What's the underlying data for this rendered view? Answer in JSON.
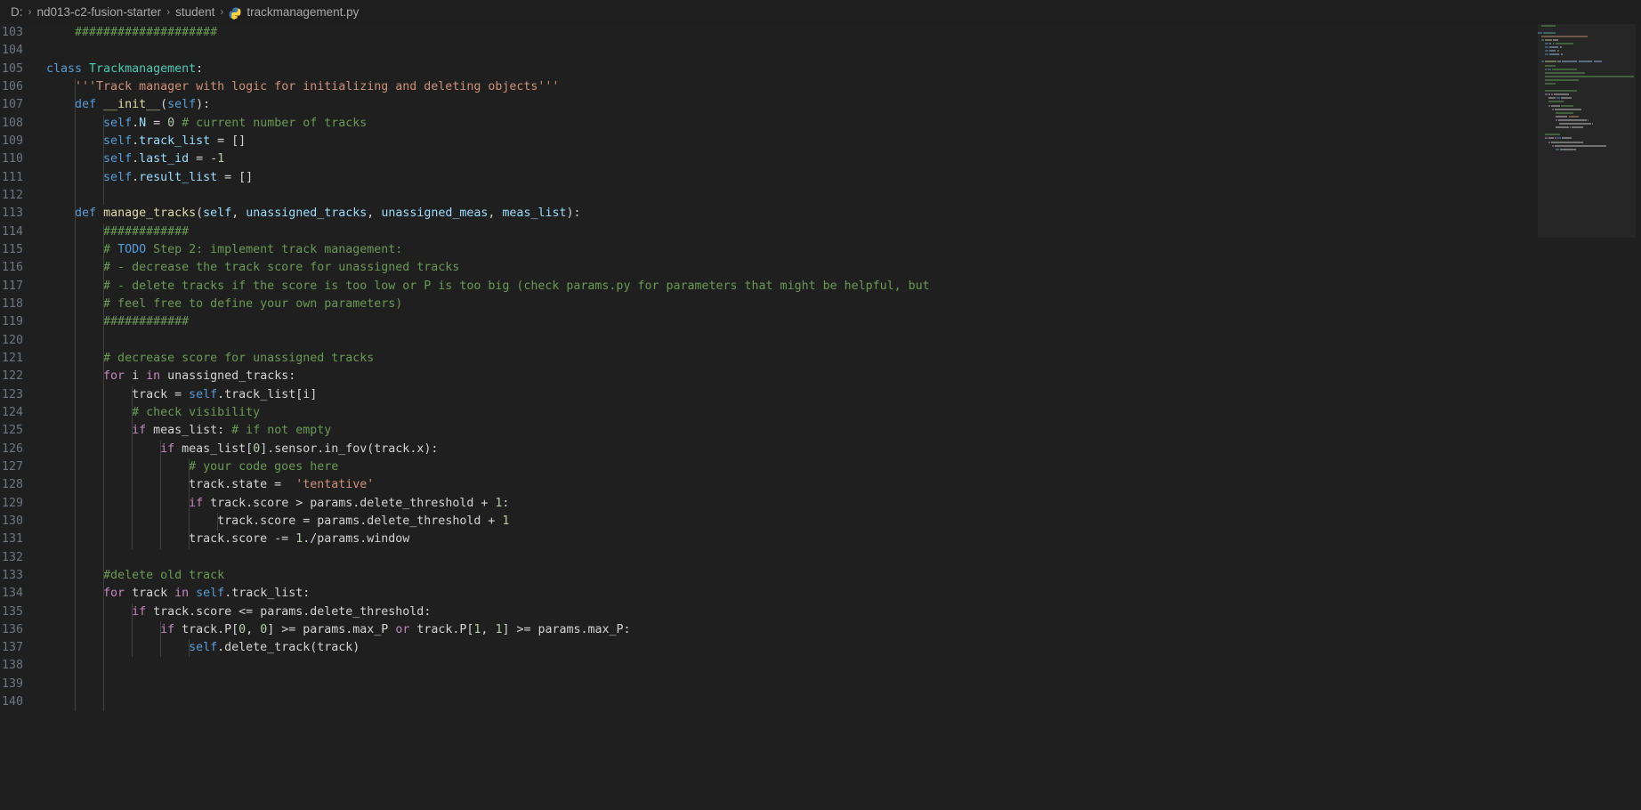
{
  "breadcrumb": {
    "drive": "D:",
    "folder": "nd013-c2-fusion-starter",
    "subfolder": "student",
    "file": "trackmanagement.py",
    "separator": "›",
    "file_icon": "python-file-icon"
  },
  "editor": {
    "language": "python",
    "first_line_number": 103,
    "last_line_number": 140,
    "theme": "dark-plus",
    "colors": {
      "background": "#1f1f1f",
      "line_number": "#6e7681",
      "foreground": "#d4d4d4",
      "keyword": "#c586c0",
      "keyword_blue": "#569cd6",
      "class_name": "#4ec9b0",
      "function": "#dcdcaa",
      "parameter": "#9cdcfe",
      "comment": "#6a9955",
      "string": "#ce9178",
      "number": "#b5cea8",
      "indent_guide": "#404040"
    }
  },
  "lines": [
    {
      "n": 103,
      "indent": 1,
      "guides": 0,
      "tokens": [
        {
          "t": "    ",
          "c": "pl"
        },
        {
          "t": "####################",
          "c": "cmt"
        }
      ]
    },
    {
      "n": 104,
      "indent": 0,
      "guides": 0,
      "tokens": []
    },
    {
      "n": 105,
      "indent": 0,
      "guides": 0,
      "tokens": [
        {
          "t": "class ",
          "c": "kw2"
        },
        {
          "t": "Trackmanagement",
          "c": "cls"
        },
        {
          "t": ":",
          "c": "pl"
        }
      ]
    },
    {
      "n": 106,
      "indent": 1,
      "guides": 1,
      "tokens": [
        {
          "t": "    ",
          "c": "pl"
        },
        {
          "t": "'''Track manager with logic for initializing and deleting objects'''",
          "c": "str"
        }
      ]
    },
    {
      "n": 107,
      "indent": 1,
      "guides": 1,
      "tokens": [
        {
          "t": "    ",
          "c": "pl"
        },
        {
          "t": "def ",
          "c": "kw2"
        },
        {
          "t": "__init__",
          "c": "fn"
        },
        {
          "t": "(",
          "c": "pl"
        },
        {
          "t": "self",
          "c": "kw2"
        },
        {
          "t": "):",
          "c": "pl"
        }
      ]
    },
    {
      "n": 108,
      "indent": 2,
      "guides": 2,
      "tokens": [
        {
          "t": "        ",
          "c": "pl"
        },
        {
          "t": "self",
          "c": "kw2"
        },
        {
          "t": ".",
          "c": "pl"
        },
        {
          "t": "N",
          "c": "param"
        },
        {
          "t": " = ",
          "c": "pl"
        },
        {
          "t": "0",
          "c": "num"
        },
        {
          "t": " ",
          "c": "pl"
        },
        {
          "t": "# current number of tracks",
          "c": "cmt"
        }
      ]
    },
    {
      "n": 109,
      "indent": 2,
      "guides": 2,
      "tokens": [
        {
          "t": "        ",
          "c": "pl"
        },
        {
          "t": "self",
          "c": "kw2"
        },
        {
          "t": ".",
          "c": "pl"
        },
        {
          "t": "track_list",
          "c": "param"
        },
        {
          "t": " = []",
          "c": "pl"
        }
      ]
    },
    {
      "n": 110,
      "indent": 2,
      "guides": 2,
      "tokens": [
        {
          "t": "        ",
          "c": "pl"
        },
        {
          "t": "self",
          "c": "kw2"
        },
        {
          "t": ".",
          "c": "pl"
        },
        {
          "t": "last_id",
          "c": "param"
        },
        {
          "t": " = -",
          "c": "pl"
        },
        {
          "t": "1",
          "c": "num"
        }
      ]
    },
    {
      "n": 111,
      "indent": 2,
      "guides": 2,
      "tokens": [
        {
          "t": "        ",
          "c": "pl"
        },
        {
          "t": "self",
          "c": "kw2"
        },
        {
          "t": ".",
          "c": "pl"
        },
        {
          "t": "result_list",
          "c": "param"
        },
        {
          "t": " = []",
          "c": "pl"
        }
      ]
    },
    {
      "n": 112,
      "indent": 0,
      "guides": 2,
      "tokens": []
    },
    {
      "n": 113,
      "indent": 1,
      "guides": 1,
      "tokens": [
        {
          "t": "    ",
          "c": "pl"
        },
        {
          "t": "def ",
          "c": "kw2"
        },
        {
          "t": "manage_tracks",
          "c": "fn"
        },
        {
          "t": "(",
          "c": "pl"
        },
        {
          "t": "self",
          "c": "param"
        },
        {
          "t": ", ",
          "c": "pl"
        },
        {
          "t": "unassigned_tracks",
          "c": "param"
        },
        {
          "t": ", ",
          "c": "pl"
        },
        {
          "t": "unassigned_meas",
          "c": "param"
        },
        {
          "t": ", ",
          "c": "pl"
        },
        {
          "t": "meas_list",
          "c": "param"
        },
        {
          "t": "):",
          "c": "pl"
        }
      ]
    },
    {
      "n": 114,
      "indent": 2,
      "guides": 2,
      "tokens": [
        {
          "t": "        ",
          "c": "pl"
        },
        {
          "t": "############",
          "c": "cmt"
        }
      ]
    },
    {
      "n": 115,
      "indent": 2,
      "guides": 2,
      "tokens": [
        {
          "t": "        ",
          "c": "pl"
        },
        {
          "t": "# ",
          "c": "cmt"
        },
        {
          "t": "TODO",
          "c": "todo"
        },
        {
          "t": " Step 2: implement track management:",
          "c": "cmt"
        }
      ]
    },
    {
      "n": 116,
      "indent": 2,
      "guides": 2,
      "tokens": [
        {
          "t": "        ",
          "c": "pl"
        },
        {
          "t": "# - decrease the track score for unassigned tracks",
          "c": "cmt"
        }
      ]
    },
    {
      "n": 117,
      "indent": 2,
      "guides": 2,
      "tokens": [
        {
          "t": "        ",
          "c": "pl"
        },
        {
          "t": "# - delete tracks if the score is too low or P is too big (check params.py for parameters that might be helpful, but",
          "c": "cmt"
        }
      ]
    },
    {
      "n": 118,
      "indent": 2,
      "guides": 2,
      "tokens": [
        {
          "t": "        ",
          "c": "pl"
        },
        {
          "t": "# feel free to define your own parameters)",
          "c": "cmt"
        }
      ]
    },
    {
      "n": 119,
      "indent": 2,
      "guides": 2,
      "tokens": [
        {
          "t": "        ",
          "c": "pl"
        },
        {
          "t": "############",
          "c": "cmt"
        }
      ]
    },
    {
      "n": 120,
      "indent": 0,
      "guides": 2,
      "tokens": []
    },
    {
      "n": 121,
      "indent": 2,
      "guides": 2,
      "tokens": [
        {
          "t": "        ",
          "c": "pl"
        },
        {
          "t": "# decrease score for unassigned tracks",
          "c": "cmt"
        }
      ]
    },
    {
      "n": 122,
      "indent": 2,
      "guides": 2,
      "tokens": [
        {
          "t": "        ",
          "c": "pl"
        },
        {
          "t": "for ",
          "c": "kw"
        },
        {
          "t": "i ",
          "c": "pl"
        },
        {
          "t": "in ",
          "c": "kw"
        },
        {
          "t": "unassigned_tracks:",
          "c": "pl"
        }
      ]
    },
    {
      "n": 123,
      "indent": 3,
      "guides": 3,
      "tokens": [
        {
          "t": "            ",
          "c": "pl"
        },
        {
          "t": "track = ",
          "c": "pl"
        },
        {
          "t": "self",
          "c": "kw2"
        },
        {
          "t": ".track_list[i]",
          "c": "pl"
        }
      ]
    },
    {
      "n": 124,
      "indent": 3,
      "guides": 3,
      "tokens": [
        {
          "t": "            ",
          "c": "pl"
        },
        {
          "t": "# check visibility",
          "c": "cmt"
        }
      ]
    },
    {
      "n": 125,
      "indent": 3,
      "guides": 3,
      "tokens": [
        {
          "t": "            ",
          "c": "pl"
        },
        {
          "t": "if ",
          "c": "kw"
        },
        {
          "t": "meas_list: ",
          "c": "pl"
        },
        {
          "t": "# if not empty",
          "c": "cmt"
        }
      ]
    },
    {
      "n": 126,
      "indent": 4,
      "guides": 4,
      "tokens": [
        {
          "t": "                ",
          "c": "pl"
        },
        {
          "t": "if ",
          "c": "kw"
        },
        {
          "t": "meas_list[",
          "c": "pl"
        },
        {
          "t": "0",
          "c": "num"
        },
        {
          "t": "].sensor.in_fov(track.x):",
          "c": "pl"
        }
      ]
    },
    {
      "n": 127,
      "indent": 5,
      "guides": 5,
      "tokens": [
        {
          "t": "                    ",
          "c": "pl"
        },
        {
          "t": "# your code goes here",
          "c": "cmt"
        }
      ]
    },
    {
      "n": 128,
      "indent": 5,
      "guides": 5,
      "tokens": [
        {
          "t": "                    ",
          "c": "pl"
        },
        {
          "t": "track.state =  ",
          "c": "pl"
        },
        {
          "t": "'tentative'",
          "c": "str"
        }
      ]
    },
    {
      "n": 129,
      "indent": 5,
      "guides": 5,
      "tokens": [
        {
          "t": "                    ",
          "c": "pl"
        },
        {
          "t": "if ",
          "c": "kw"
        },
        {
          "t": "track.score > params.delete_threshold + ",
          "c": "pl"
        },
        {
          "t": "1",
          "c": "num"
        },
        {
          "t": ":",
          "c": "pl"
        }
      ]
    },
    {
      "n": 130,
      "indent": 6,
      "guides": 6,
      "tokens": [
        {
          "t": "                        ",
          "c": "pl"
        },
        {
          "t": "track.score = params.delete_threshold + ",
          "c": "pl"
        },
        {
          "t": "1",
          "c": "num"
        }
      ]
    },
    {
      "n": 131,
      "indent": 5,
      "guides": 5,
      "tokens": [
        {
          "t": "                    ",
          "c": "pl"
        },
        {
          "t": "track.score -= ",
          "c": "pl"
        },
        {
          "t": "1",
          "c": "num"
        },
        {
          "t": "./params.window",
          "c": "pl"
        }
      ]
    },
    {
      "n": 132,
      "indent": 0,
      "guides": 2,
      "tokens": []
    },
    {
      "n": 133,
      "indent": 2,
      "guides": 2,
      "tokens": [
        {
          "t": "        ",
          "c": "pl"
        },
        {
          "t": "#delete old track",
          "c": "cmt"
        }
      ]
    },
    {
      "n": 134,
      "indent": 2,
      "guides": 2,
      "tokens": [
        {
          "t": "        ",
          "c": "pl"
        },
        {
          "t": "for ",
          "c": "kw"
        },
        {
          "t": "track ",
          "c": "pl"
        },
        {
          "t": "in ",
          "c": "kw"
        },
        {
          "t": "self",
          "c": "kw2"
        },
        {
          "t": ".track_list:",
          "c": "pl"
        }
      ]
    },
    {
      "n": 135,
      "indent": 3,
      "guides": 3,
      "tokens": [
        {
          "t": "            ",
          "c": "pl"
        },
        {
          "t": "if ",
          "c": "kw"
        },
        {
          "t": "track.score <= params.delete_threshold:",
          "c": "pl"
        }
      ]
    },
    {
      "n": 136,
      "indent": 4,
      "guides": 4,
      "tokens": [
        {
          "t": "                ",
          "c": "pl"
        },
        {
          "t": "if ",
          "c": "kw"
        },
        {
          "t": "track.P[",
          "c": "pl"
        },
        {
          "t": "0",
          "c": "num"
        },
        {
          "t": ", ",
          "c": "pl"
        },
        {
          "t": "0",
          "c": "num"
        },
        {
          "t": "] >= params.max_P ",
          "c": "pl"
        },
        {
          "t": "or ",
          "c": "kw"
        },
        {
          "t": "track.P[",
          "c": "pl"
        },
        {
          "t": "1",
          "c": "num"
        },
        {
          "t": ", ",
          "c": "pl"
        },
        {
          "t": "1",
          "c": "num"
        },
        {
          "t": "] >= params.max_P:",
          "c": "pl"
        }
      ]
    },
    {
      "n": 137,
      "indent": 5,
      "guides": 5,
      "tokens": [
        {
          "t": "                    ",
          "c": "pl"
        },
        {
          "t": "self",
          "c": "kw2"
        },
        {
          "t": ".delete_track(track)",
          "c": "pl"
        }
      ]
    },
    {
      "n": 138,
      "indent": 0,
      "guides": 2,
      "tokens": []
    },
    {
      "n": 139,
      "indent": 0,
      "guides": 2,
      "tokens": []
    },
    {
      "n": 140,
      "indent": 0,
      "guides": 2,
      "tokens": []
    }
  ],
  "minimap": {
    "name": "code-minimap",
    "visible": true,
    "rows": [
      [
        [
          4,
          "cmt",
          16
        ]
      ],
      [],
      [
        [
          0,
          "kw2",
          5
        ],
        [
          6,
          "cls",
          14
        ]
      ],
      [
        [
          4,
          "str",
          52
        ]
      ],
      [
        [
          4,
          "kw2",
          3
        ],
        [
          8,
          "fn",
          8
        ],
        [
          17,
          "pl",
          6
        ]
      ],
      [
        [
          8,
          "kw2",
          4
        ],
        [
          13,
          "param",
          2
        ],
        [
          17,
          "num",
          1
        ],
        [
          20,
          "cmt",
          20
        ]
      ],
      [
        [
          8,
          "kw2",
          4
        ],
        [
          13,
          "param",
          10
        ],
        [
          25,
          "pl",
          2
        ]
      ],
      [
        [
          8,
          "kw2",
          4
        ],
        [
          13,
          "param",
          7
        ],
        [
          22,
          "num",
          2
        ]
      ],
      [
        [
          8,
          "kw2",
          4
        ],
        [
          13,
          "param",
          11
        ],
        [
          26,
          "pl",
          2
        ]
      ],
      [],
      [
        [
          4,
          "kw2",
          3
        ],
        [
          8,
          "fn",
          13
        ],
        [
          22,
          "param",
          4
        ],
        [
          27,
          "param",
          17
        ],
        [
          46,
          "param",
          15
        ],
        [
          63,
          "param",
          9
        ]
      ],
      [
        [
          8,
          "cmt",
          12
        ]
      ],
      [
        [
          8,
          "cmt",
          2
        ],
        [
          11,
          "todo",
          4
        ],
        [
          16,
          "cmt",
          28
        ]
      ],
      [
        [
          8,
          "cmt",
          45
        ]
      ],
      [
        [
          8,
          "cmt",
          100
        ]
      ],
      [
        [
          8,
          "cmt",
          38
        ]
      ],
      [
        [
          8,
          "cmt",
          12
        ]
      ],
      [],
      [
        [
          8,
          "cmt",
          36
        ]
      ],
      [
        [
          8,
          "kw",
          3
        ],
        [
          12,
          "pl",
          2
        ],
        [
          15,
          "kw",
          2
        ],
        [
          18,
          "pl",
          17
        ]
      ],
      [
        [
          12,
          "pl",
          8
        ],
        [
          21,
          "kw2",
          4
        ],
        [
          26,
          "pl",
          12
        ]
      ],
      [
        [
          12,
          "cmt",
          17
        ]
      ],
      [
        [
          12,
          "kw",
          2
        ],
        [
          15,
          "pl",
          10
        ],
        [
          26,
          "cmt",
          14
        ]
      ],
      [
        [
          16,
          "kw",
          2
        ],
        [
          19,
          "pl",
          30
        ]
      ],
      [
        [
          20,
          "cmt",
          20
        ]
      ],
      [
        [
          20,
          "pl",
          13
        ],
        [
          35,
          "str",
          11
        ]
      ],
      [
        [
          20,
          "kw",
          2
        ],
        [
          23,
          "pl",
          32
        ],
        [
          56,
          "num",
          1
        ]
      ],
      [
        [
          24,
          "pl",
          36
        ],
        [
          61,
          "num",
          1
        ]
      ],
      [
        [
          20,
          "pl",
          15
        ],
        [
          36,
          "num",
          1
        ],
        [
          38,
          "pl",
          13
        ]
      ],
      [],
      [
        [
          8,
          "cmt",
          17
        ]
      ],
      [
        [
          8,
          "kw",
          3
        ],
        [
          12,
          "pl",
          6
        ],
        [
          19,
          "kw",
          2
        ],
        [
          22,
          "kw2",
          4
        ],
        [
          27,
          "pl",
          11
        ]
      ],
      [
        [
          12,
          "kw",
          2
        ],
        [
          15,
          "pl",
          36
        ]
      ],
      [
        [
          16,
          "kw",
          2
        ],
        [
          19,
          "pl",
          58
        ]
      ],
      [
        [
          20,
          "kw2",
          4
        ],
        [
          25,
          "pl",
          18
        ]
      ],
      [],
      [],
      []
    ]
  }
}
